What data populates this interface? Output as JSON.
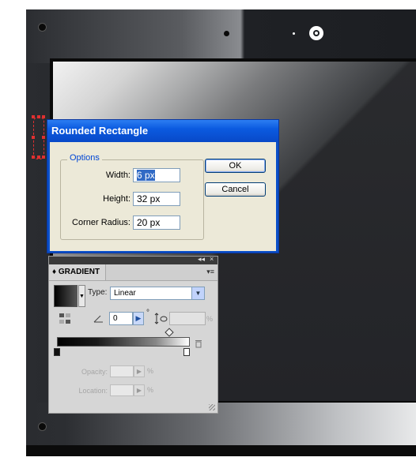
{
  "dialog": {
    "title": "Rounded Rectangle",
    "options_legend": "Options",
    "fields": [
      {
        "label": "Width:",
        "value": "6 px",
        "selected": true
      },
      {
        "label": "Height:",
        "value": "32 px"
      },
      {
        "label": "Corner Radius:",
        "value": "20 px"
      }
    ],
    "ok_label": "OK",
    "cancel_label": "Cancel"
  },
  "gradient_panel": {
    "tab_label": "GRADIENT",
    "tab_arrows": "♦",
    "collapse_glyph": "◂◂",
    "close_glyph": "×",
    "menu_glyph": "▾≡",
    "type_label": "Type:",
    "type_value": "Linear",
    "angle_value": "0",
    "angle_unit": "°",
    "ratio_unit": "%",
    "opacity_label": "Opacity:",
    "location_label": "Location:",
    "opacity_unit": "%",
    "location_unit": "%"
  },
  "colors": {
    "titlebar": "#0b5ae0",
    "dialog_face": "#ece9d8",
    "panel_face": "#d6d6d6",
    "selection": "#e03030"
  },
  "icons": [
    "screw-icon",
    "reverse-gradient-icon",
    "angle-icon",
    "aspect-ratio-icon",
    "trash-icon",
    "dropdown-arrow-icon",
    "stepper-arrow-icon",
    "resize-grip-icon"
  ]
}
